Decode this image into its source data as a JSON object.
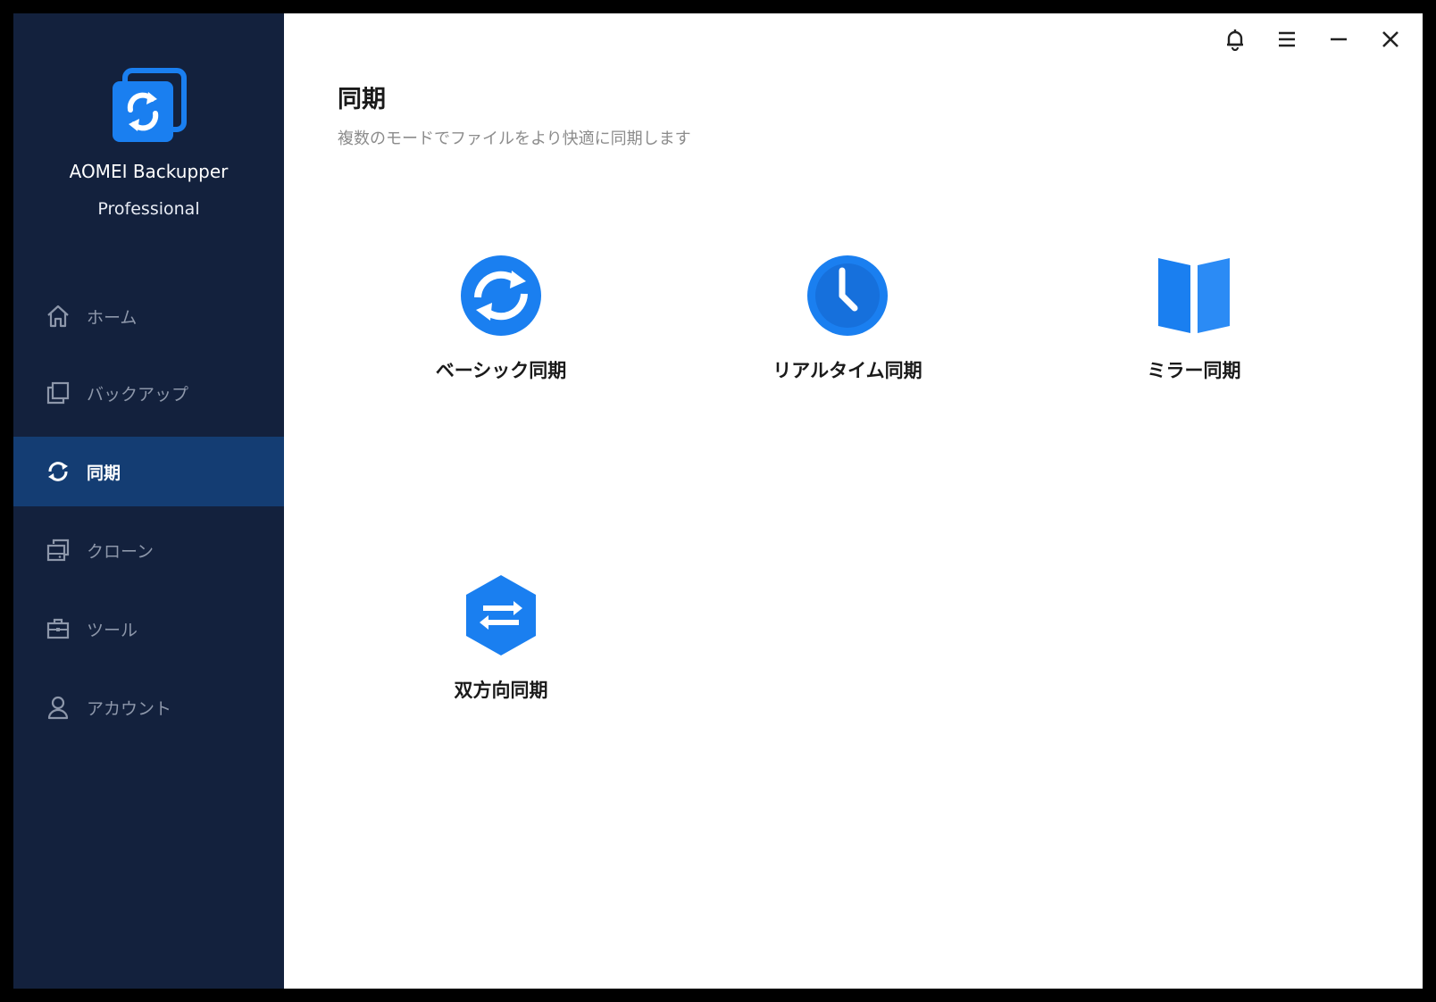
{
  "app": {
    "name": "AOMEI Backupper",
    "edition": "Professional"
  },
  "colors": {
    "sidebar_bg": "#13213d",
    "sidebar_active": "#143d73",
    "accent_blue": "#1a7ff0",
    "text_dark": "#1a1a1a",
    "text_muted": "#8c8c8c"
  },
  "sidebar": {
    "items": [
      {
        "label": "ホーム",
        "icon": "home-icon",
        "active": false
      },
      {
        "label": "バックアップ",
        "icon": "backup-icon",
        "active": false
      },
      {
        "label": "同期",
        "icon": "sync-icon",
        "active": true
      },
      {
        "label": "クローン",
        "icon": "clone-icon",
        "active": false
      },
      {
        "label": "ツール",
        "icon": "toolbox-icon",
        "active": false
      },
      {
        "label": "アカウント",
        "icon": "user-icon",
        "active": false
      }
    ]
  },
  "titlebar": {
    "icons": [
      "bell-icon",
      "menu-icon",
      "minimize-icon",
      "close-icon"
    ]
  },
  "main": {
    "title": "同期",
    "subtitle": "複数のモードでファイルをより快適に同期します",
    "options": [
      {
        "label": "ベーシック同期",
        "icon": "basic-sync-icon"
      },
      {
        "label": "リアルタイム同期",
        "icon": "realtime-sync-icon"
      },
      {
        "label": "ミラー同期",
        "icon": "mirror-sync-icon"
      },
      {
        "label": "双方向同期",
        "icon": "two-way-sync-icon"
      }
    ]
  }
}
